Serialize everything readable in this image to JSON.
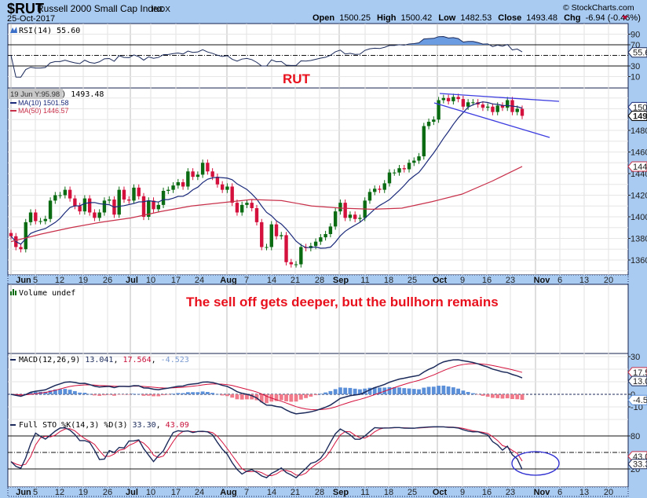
{
  "header": {
    "symbol": "$RUT",
    "name": "Russell 2000 Small Cap Index",
    "exchange": "INDX",
    "date": "25-Oct-2017",
    "watermark": "© StockCharts.com",
    "quote": {
      "open_label": "Open",
      "open": "1500.25",
      "high_label": "High",
      "high": "1500.42",
      "low_label": "Low",
      "low": "1482.53",
      "close_label": "Close",
      "close": "1493.48",
      "chg_label": "Chg",
      "chg": "-6.94 (-0.46%)",
      "chg_direction": "down"
    }
  },
  "tooltip": "19 Jun Y:95.98",
  "annotations": {
    "rut": "RUT",
    "comment": "The sell off gets deeper, but the bullhorn remains",
    "color": "#e8101c"
  },
  "chart_data": {
    "type": "candlestick",
    "price_panel": {
      "legend": "$RUT (Daily) 1493.48",
      "ma10_label": "MA(10) 1501.58",
      "ma50_label": "MA(50) 1446.57",
      "y_ticks": [
        "1360",
        "1380",
        "1400",
        "1420",
        "1440",
        "1460",
        "1480"
      ],
      "ylim": [
        1346,
        1519
      ],
      "tags": {
        "ma10": "1501",
        "close": "1493",
        "ma50": "1446"
      },
      "close": [
        1382,
        1372,
        1370,
        1395,
        1404,
        1396,
        1396,
        1398,
        1415,
        1420,
        1420,
        1425,
        1417,
        1410,
        1405,
        1417,
        1404,
        1399,
        1404,
        1415,
        1416,
        1402,
        1425,
        1416,
        1415,
        1427,
        1419,
        1400,
        1415,
        1407,
        1411,
        1424,
        1425,
        1429,
        1432,
        1428,
        1442,
        1437,
        1439,
        1450,
        1442,
        1437,
        1430,
        1425,
        1428,
        1413,
        1404,
        1411,
        1413,
        1408,
        1395,
        1372,
        1372,
        1393,
        1382,
        1383,
        1358,
        1356,
        1356,
        1372,
        1371,
        1373,
        1377,
        1381,
        1384,
        1391,
        1405,
        1413,
        1399,
        1402,
        1398,
        1399,
        1415,
        1423,
        1426,
        1425,
        1431,
        1441,
        1441,
        1445,
        1444,
        1450,
        1452,
        1456,
        1484,
        1488,
        1490,
        1508,
        1510,
        1507,
        1511,
        1509,
        1502,
        1506,
        1506,
        1504,
        1501,
        1502,
        1497,
        1503,
        1501,
        1508,
        1497,
        1500,
        1493.48
      ],
      "ma50_sampled": [
        1377,
        1384,
        1390,
        1395,
        1399,
        1405,
        1410,
        1413,
        1416,
        1415,
        1410,
        1408,
        1407,
        1408,
        1414,
        1421,
        1433,
        1446.57
      ],
      "colors": {
        "up": "#0b6b12",
        "down": "#d4103c",
        "ma10": "#1b2a7a",
        "ma50": "#c8304a",
        "trendline": "#3c3ce0"
      }
    },
    "x_ticks": [
      {
        "label": "Jun",
        "bold": true
      },
      {
        "label": "5"
      },
      {
        "label": "12"
      },
      {
        "label": "19"
      },
      {
        "label": "26"
      },
      {
        "label": "Jul",
        "bold": true
      },
      {
        "label": "10"
      },
      {
        "label": "17"
      },
      {
        "label": "24"
      },
      {
        "label": "Aug",
        "bold": true
      },
      {
        "label": "7"
      },
      {
        "label": "14"
      },
      {
        "label": "21"
      },
      {
        "label": "28"
      },
      {
        "label": "Sep",
        "bold": true
      },
      {
        "label": "11"
      },
      {
        "label": "18"
      },
      {
        "label": "25"
      },
      {
        "label": "Oct",
        "bold": true
      },
      {
        "label": "9"
      },
      {
        "label": "16"
      },
      {
        "label": "23"
      },
      {
        "label": "Nov",
        "bold": true
      },
      {
        "label": "6"
      },
      {
        "label": "13"
      },
      {
        "label": "20"
      }
    ],
    "rsi_panel": {
      "legend": "RSI(14) 55.60",
      "y_ticks": [
        "90",
        "70",
        "30",
        "10"
      ],
      "tag": "55.6",
      "overbought": 70,
      "oversold": 30,
      "fill_color": "#6b9be0"
    },
    "volume_panel": {
      "legend": "Volume undef"
    },
    "macd_panel": {
      "legend_prefix": "MACD(12,26,9)",
      "macd": "13.041",
      "signal": "17.564",
      "hist": "-4.523",
      "y_ticks": [
        "30",
        "0",
        "-10"
      ],
      "tags": {
        "signal": "17.5",
        "macd": "13.0",
        "hist": "-4.52"
      },
      "colors": {
        "macd": "#1b2a5a",
        "signal": "#d4103c",
        "hist_pos": "#5b8fd8",
        "hist_neg": "#f07a8a"
      }
    },
    "sto_panel": {
      "legend_prefix": "Full STO %K(14,3) %D(3)",
      "k": "33.30",
      "d": "43.09",
      "y_ticks": [
        "80",
        "20"
      ],
      "tags": {
        "d": "43.0",
        "k": "33.3"
      }
    }
  }
}
